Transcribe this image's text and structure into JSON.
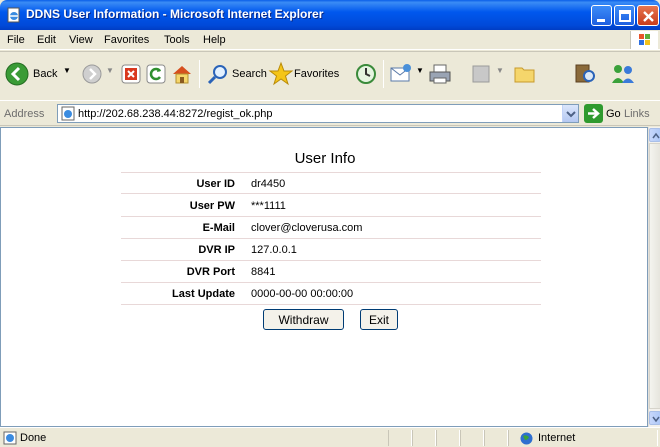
{
  "window": {
    "title": "DDNS User Information - Microsoft Internet Explorer"
  },
  "menu": [
    "File",
    "Edit",
    "View",
    "Favorites",
    "Tools",
    "Help"
  ],
  "toolbar": {
    "back_label": "Back",
    "search_label": "Search",
    "favorites_label": "Favorites"
  },
  "address": {
    "label": "Address",
    "url": "http://202.68.238.44:8272/regist_ok.php",
    "go_label": "Go",
    "links_label": "Links"
  },
  "page": {
    "title": "User Info",
    "rows": [
      {
        "label": "User ID",
        "value": "dr4450"
      },
      {
        "label": "User PW",
        "value": "***1111"
      },
      {
        "label": "E-Mail",
        "value": "clover@cloverusa.com"
      },
      {
        "label": "DVR IP",
        "value": "127.0.0.1"
      },
      {
        "label": "DVR Port",
        "value": "8841"
      },
      {
        "label": "Last Update",
        "value": "0000-00-00 00:00:00"
      }
    ],
    "withdraw_label": "Withdraw",
    "exit_label": "Exit"
  },
  "status": {
    "text": "Done",
    "zone": "Internet"
  }
}
